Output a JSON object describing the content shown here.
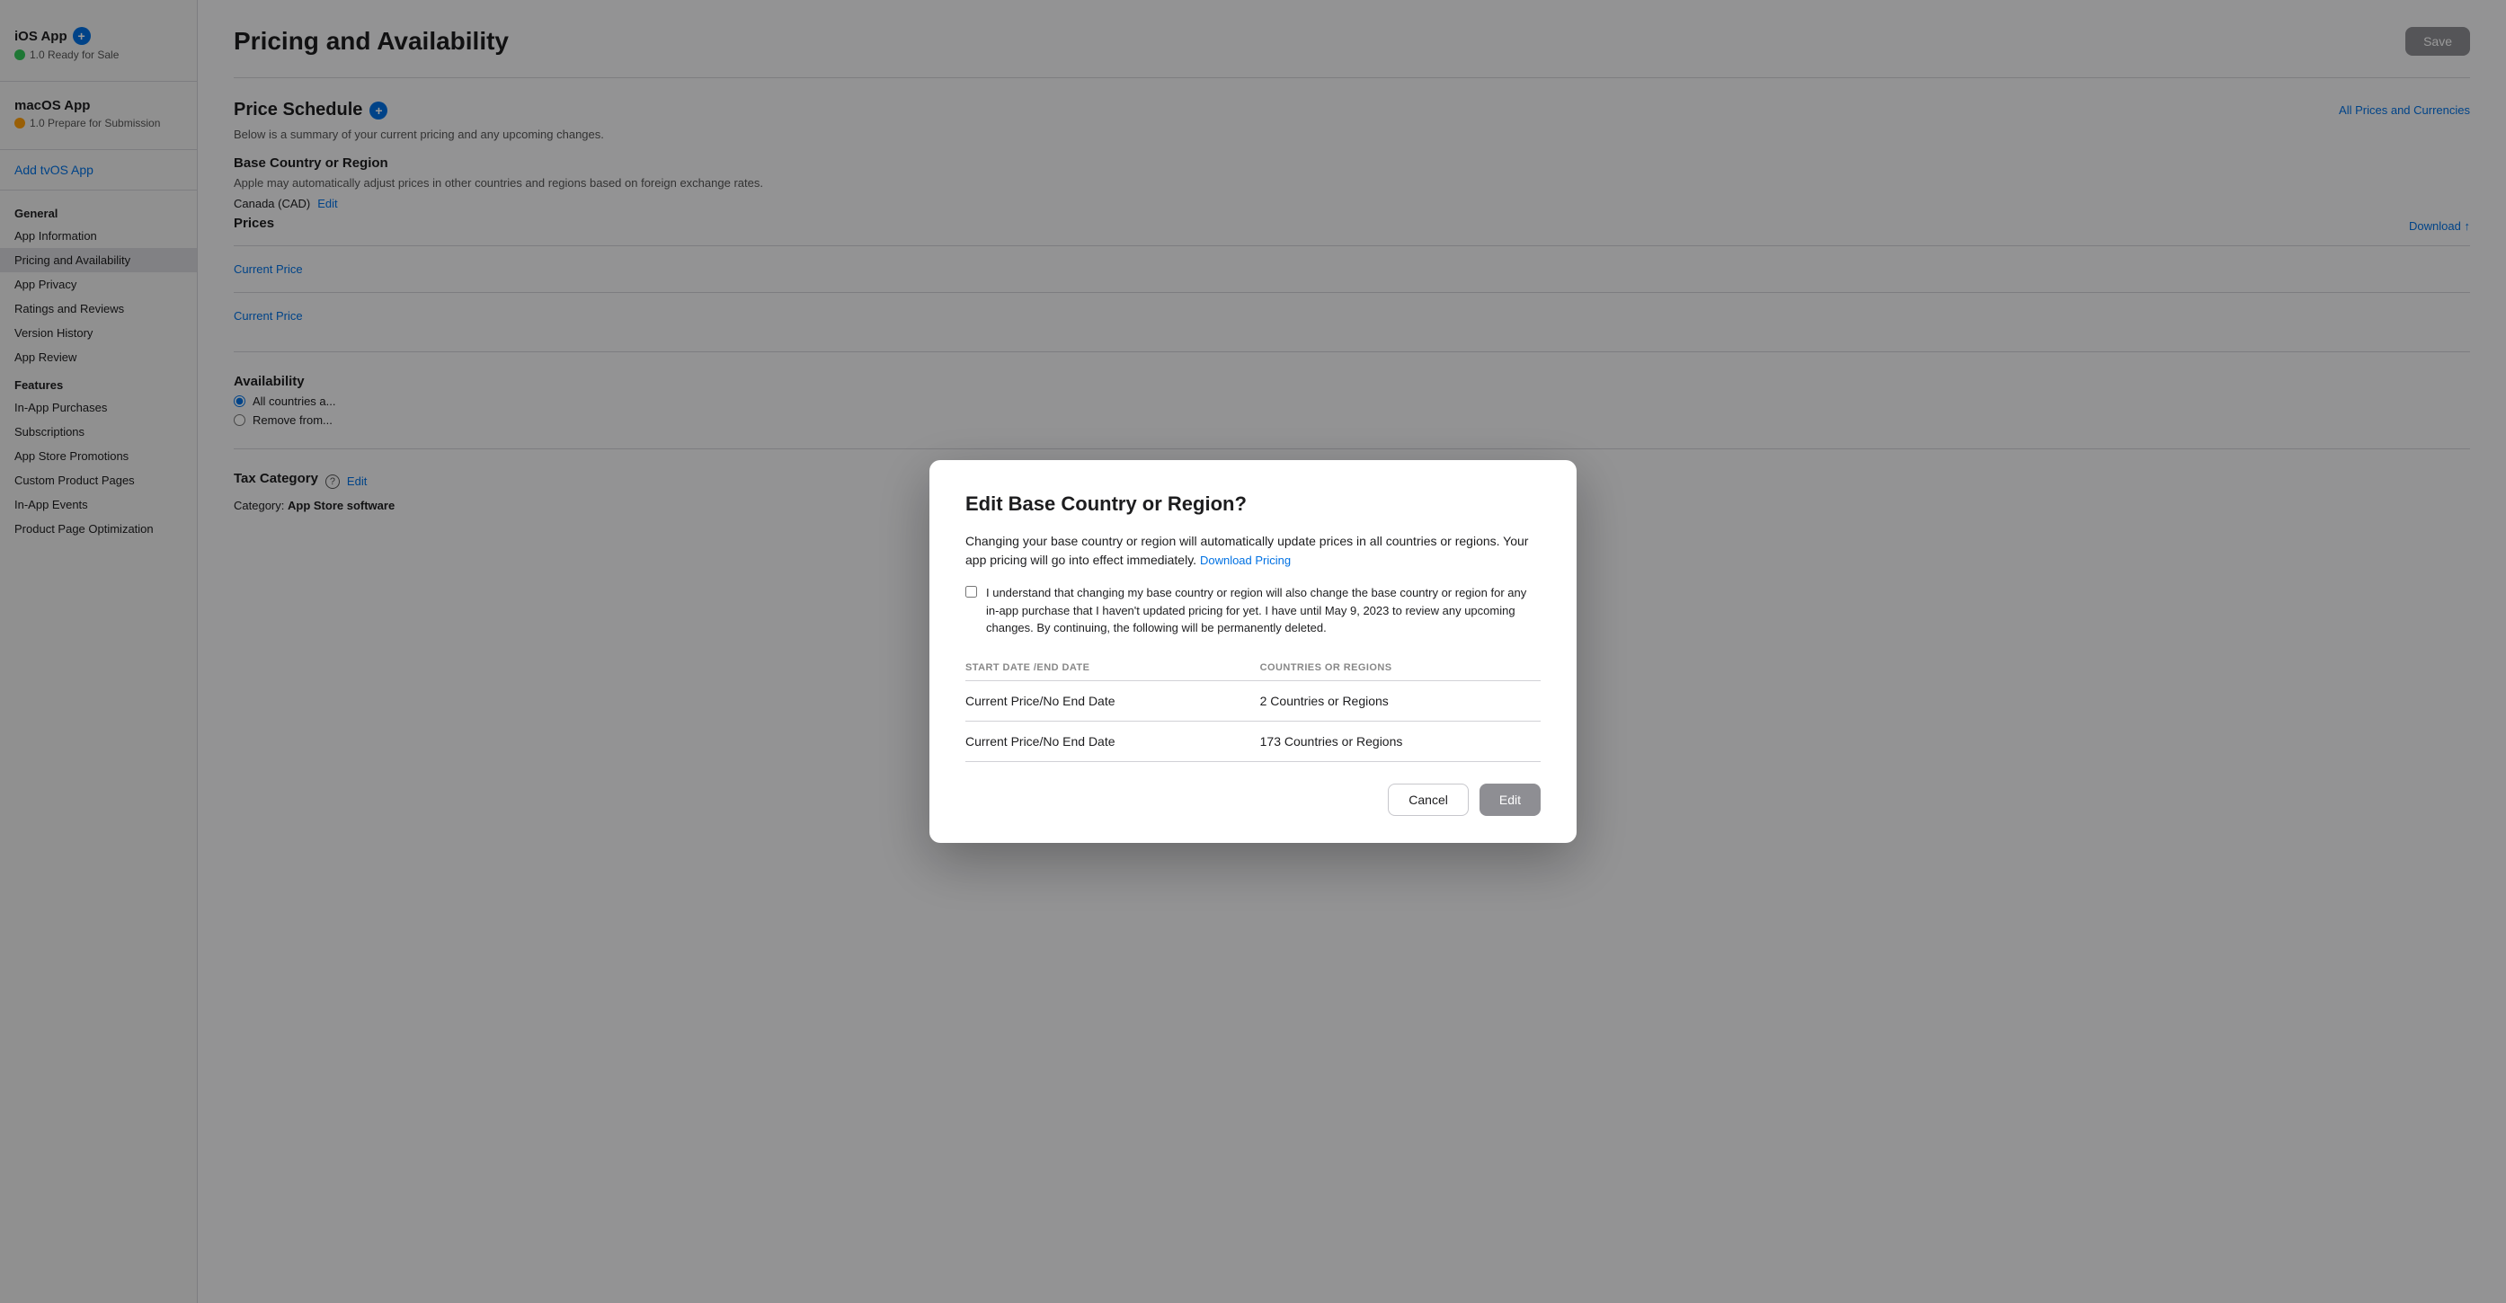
{
  "sidebar": {
    "ios_app": {
      "title": "iOS App",
      "status": "1.0 Ready for Sale"
    },
    "macos_app": {
      "title": "macOS App",
      "status": "1.0 Prepare for Submission"
    },
    "add_tv_link": "Add tvOS App",
    "general_header": "General",
    "general_items": [
      {
        "label": "App Information",
        "id": "app-information",
        "active": false
      },
      {
        "label": "Pricing and Availability",
        "id": "pricing-availability",
        "active": true
      },
      {
        "label": "App Privacy",
        "id": "app-privacy",
        "active": false
      },
      {
        "label": "Ratings and Reviews",
        "id": "ratings-reviews",
        "active": false
      },
      {
        "label": "Version History",
        "id": "version-history",
        "active": false
      },
      {
        "label": "App Review",
        "id": "app-review",
        "active": false
      }
    ],
    "features_header": "Features",
    "features_items": [
      {
        "label": "In-App Purchases",
        "id": "in-app-purchases",
        "active": false
      },
      {
        "label": "Subscriptions",
        "id": "subscriptions",
        "active": false
      },
      {
        "label": "App Store Promotions",
        "id": "app-store-promotions",
        "active": false
      },
      {
        "label": "Custom Product Pages",
        "id": "custom-product-pages",
        "active": false
      },
      {
        "label": "In-App Events",
        "id": "in-app-events",
        "active": false
      },
      {
        "label": "Product Page Optimization",
        "id": "product-page-optimization",
        "active": false
      }
    ]
  },
  "main": {
    "page_title": "Pricing and Availability",
    "save_label": "Save",
    "all_prices_link": "All Prices and Currencies",
    "download_link": "Download",
    "price_schedule": {
      "title": "Price Schedule",
      "subtitle": "Below is a summary of your current pricing and any upcoming changes."
    },
    "base_country": {
      "title": "Base Country or Region",
      "description": "Apple may automatically adjust prices in other countries and regions based on foreign exchange rates.",
      "current": "Canada (CAD)",
      "edit_link": "Edit"
    },
    "prices": {
      "title": "Prices",
      "current_price_1": "Current Price",
      "current_price_2": "Current Price"
    },
    "availability": {
      "title": "Availability",
      "radio1": "All countries a...",
      "radio2": "Remove from..."
    },
    "tax_category": {
      "title": "Tax Category",
      "edit_link": "Edit",
      "category_label": "Category:",
      "category_value": "App Store software"
    }
  },
  "modal": {
    "title": "Edit Base Country or Region?",
    "description": "Changing your base country or region will automatically update prices in all countries or regions. Your app pricing will go into effect immediately.",
    "download_pricing_link": "Download Pricing",
    "checkbox_text": "I understand that changing my base country or region will also change the base country or region for any in-app purchase that I haven't updated pricing for yet. I have until May 9, 2023 to review any upcoming changes. By continuing, the following will be permanently deleted.",
    "table": {
      "col1_header": "START DATE /END DATE",
      "col2_header": "COUNTRIES OR REGIONS",
      "rows": [
        {
          "date": "Current Price/No End Date",
          "regions": "2 Countries or Regions"
        },
        {
          "date": "Current Price/No End Date",
          "regions": "173 Countries or Regions"
        }
      ]
    },
    "cancel_label": "Cancel",
    "edit_label": "Edit"
  }
}
